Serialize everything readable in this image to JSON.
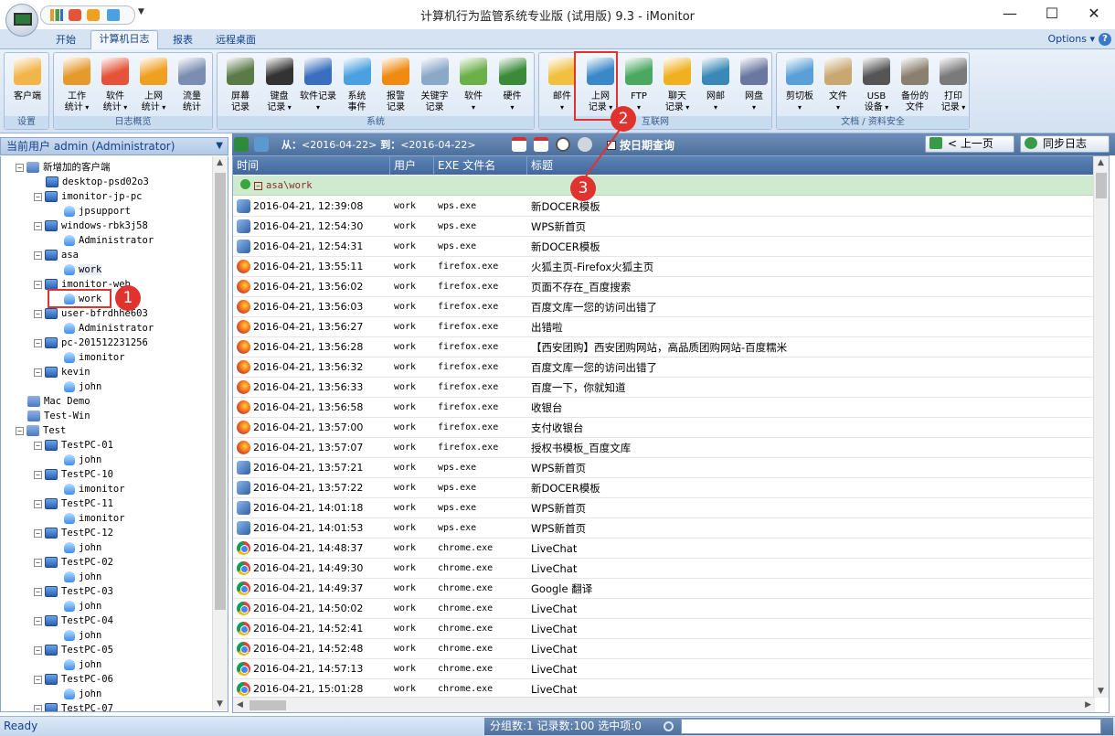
{
  "window": {
    "title": "计算机行为监管系统专业版 (试用版) 9.3 - iMonitor",
    "minimize": "—",
    "maximize": "☐",
    "close": "✕"
  },
  "ribbon_tabs": [
    {
      "label": "开始"
    },
    {
      "label": "计算机日志",
      "active": true
    },
    {
      "label": "报表"
    },
    {
      "label": "远程桌面"
    }
  ],
  "options_label": "Options",
  "ribbon_groups": [
    {
      "label": "设置",
      "buttons": [
        {
          "l1": "客户端",
          "l2": "",
          "icon": "client-icon",
          "color": "#f2b54a"
        }
      ]
    },
    {
      "label": "日志概览",
      "buttons": [
        {
          "l1": "工作",
          "l2": "统计",
          "icon": "work-stats-icon",
          "color": "#e59a2c",
          "dd": true
        },
        {
          "l1": "软件",
          "l2": "统计",
          "icon": "software-stats-icon",
          "color": "#e5533a",
          "dd": true
        },
        {
          "l1": "上网",
          "l2": "统计",
          "icon": "web-stats-icon",
          "color": "#f0a020",
          "dd": true
        },
        {
          "l1": "流量",
          "l2": "统计",
          "icon": "traffic-stats-icon",
          "color": "#7b8db0"
        }
      ]
    },
    {
      "label": "系统",
      "buttons": [
        {
          "l1": "屏幕",
          "l2": "记录",
          "icon": "screen-icon",
          "color": "#5a7a48"
        },
        {
          "l1": "键盘",
          "l2": "记录",
          "icon": "keyboard-icon",
          "color": "#333333",
          "dd": true
        },
        {
          "l1": "软件记录",
          "l2": "",
          "icon": "software-log-icon",
          "color": "#3a6fc0",
          "dd": true
        },
        {
          "l1": "系统",
          "l2": "事件",
          "icon": "system-event-icon",
          "color": "#4aa0e0"
        },
        {
          "l1": "报警",
          "l2": "记录",
          "icon": "alarm-icon",
          "color": "#f08a10"
        },
        {
          "l1": "关键字",
          "l2": "记录",
          "icon": "keyword-icon",
          "color": "#8aa8c8"
        },
        {
          "l1": "软件",
          "l2": "",
          "icon": "software-icon",
          "color": "#6cb04a",
          "dd": true
        },
        {
          "l1": "硬件",
          "l2": "",
          "icon": "hardware-icon",
          "color": "#3a8a3a",
          "dd": true
        }
      ]
    },
    {
      "label": "互联网",
      "buttons": [
        {
          "l1": "邮件",
          "l2": "",
          "icon": "mail-icon",
          "color": "#f2c040",
          "dd": true
        },
        {
          "l1": "上网",
          "l2": "记录",
          "icon": "web-log-icon",
          "color": "#3a88c8",
          "dd": true
        },
        {
          "l1": "FTP",
          "l2": "",
          "icon": "ftp-icon",
          "color": "#4aa860",
          "dd": true
        },
        {
          "l1": "聊天",
          "l2": "记录",
          "icon": "chat-icon",
          "color": "#f0b020",
          "dd": true
        },
        {
          "l1": "网邮",
          "l2": "",
          "icon": "webmail-icon",
          "color": "#3a88b8",
          "dd": true
        },
        {
          "l1": "网盘",
          "l2": "",
          "icon": "netdisk-icon",
          "color": "#6a78a0",
          "dd": true
        }
      ]
    },
    {
      "label": "文档 / 资料安全",
      "buttons": [
        {
          "l1": "剪切板",
          "l2": "",
          "icon": "clipboard-icon",
          "color": "#5aa0d8",
          "dd": true
        },
        {
          "l1": "文件",
          "l2": "",
          "icon": "file-icon",
          "color": "#c8a870",
          "dd": true
        },
        {
          "l1": "USB",
          "l2": "设备",
          "icon": "usb-icon",
          "color": "#555555",
          "dd": true
        },
        {
          "l1": "备份的",
          "l2": "文件",
          "icon": "backup-icon",
          "color": "#8a8070"
        },
        {
          "l1": "打印",
          "l2": "记录",
          "icon": "print-icon",
          "color": "#7a7a7a",
          "dd": true
        }
      ]
    }
  ],
  "current_user_label": "当前用户 admin (Administrator)",
  "tree": [
    {
      "label": "新增加的客户端",
      "lvl": 0,
      "type": "group",
      "exp": "-"
    },
    {
      "label": "desktop-psd02o3",
      "lvl": 1,
      "type": "pc"
    },
    {
      "label": "imonitor-jp-pc",
      "lvl": 1,
      "type": "pc",
      "exp": "-"
    },
    {
      "label": "jpsupport",
      "lvl": 2,
      "type": "user"
    },
    {
      "label": "windows-rbk3j58",
      "lvl": 1,
      "type": "pc",
      "exp": "-"
    },
    {
      "label": "Administrator",
      "lvl": 2,
      "type": "user"
    },
    {
      "label": "asa",
      "lvl": 1,
      "type": "pc",
      "exp": "-"
    },
    {
      "label": "work",
      "lvl": 2,
      "type": "user",
      "selected": true
    },
    {
      "label": "imonitor-web",
      "lvl": 1,
      "type": "pc",
      "exp": "-"
    },
    {
      "label": "work",
      "lvl": 2,
      "type": "user"
    },
    {
      "label": "user-bfrdhhe603",
      "lvl": 1,
      "type": "pc",
      "exp": "-"
    },
    {
      "label": "Administrator",
      "lvl": 2,
      "type": "user"
    },
    {
      "label": "pc-201512231256",
      "lvl": 1,
      "type": "pc",
      "exp": "-"
    },
    {
      "label": "imonitor",
      "lvl": 2,
      "type": "user"
    },
    {
      "label": "kevin",
      "lvl": 1,
      "type": "pc",
      "exp": "-"
    },
    {
      "label": "john",
      "lvl": 2,
      "type": "user"
    },
    {
      "label": "Mac Demo",
      "lvl": 0,
      "type": "group"
    },
    {
      "label": "Test-Win",
      "lvl": 0,
      "type": "group"
    },
    {
      "label": "Test",
      "lvl": 0,
      "type": "group",
      "exp": "-"
    },
    {
      "label": "TestPC-01",
      "lvl": 1,
      "type": "pc",
      "exp": "-"
    },
    {
      "label": "john",
      "lvl": 2,
      "type": "user"
    },
    {
      "label": "TestPC-10",
      "lvl": 1,
      "type": "pc",
      "exp": "-"
    },
    {
      "label": "imonitor",
      "lvl": 2,
      "type": "user"
    },
    {
      "label": "TestPC-11",
      "lvl": 1,
      "type": "pc",
      "exp": "-"
    },
    {
      "label": "imonitor",
      "lvl": 2,
      "type": "user"
    },
    {
      "label": "TestPC-12",
      "lvl": 1,
      "type": "pc",
      "exp": "-"
    },
    {
      "label": "john",
      "lvl": 2,
      "type": "user"
    },
    {
      "label": "TestPC-02",
      "lvl": 1,
      "type": "pc",
      "exp": "-"
    },
    {
      "label": "john",
      "lvl": 2,
      "type": "user"
    },
    {
      "label": "TestPC-03",
      "lvl": 1,
      "type": "pc",
      "exp": "-"
    },
    {
      "label": "john",
      "lvl": 2,
      "type": "user"
    },
    {
      "label": "TestPC-04",
      "lvl": 1,
      "type": "pc",
      "exp": "-"
    },
    {
      "label": "john",
      "lvl": 2,
      "type": "user"
    },
    {
      "label": "TestPC-05",
      "lvl": 1,
      "type": "pc",
      "exp": "-"
    },
    {
      "label": "john",
      "lvl": 2,
      "type": "user"
    },
    {
      "label": "TestPC-06",
      "lvl": 1,
      "type": "pc",
      "exp": "-"
    },
    {
      "label": "john",
      "lvl": 2,
      "type": "user"
    },
    {
      "label": "TestPC-07",
      "lvl": 1,
      "type": "pc",
      "exp": "-"
    }
  ],
  "toolbar": {
    "from_label": "从：",
    "from_date": "<2016-04-22>",
    "to_label": " 到：",
    "to_date": "<2016-04-22>",
    "by_date_query": "按日期查询",
    "prev_page": "< 上一页",
    "sync_log": "同步日志"
  },
  "columns": [
    "时间",
    "用户",
    "EXE 文件名",
    "标题"
  ],
  "group_row": "asa\\work",
  "rows": [
    {
      "icon": "wps",
      "time": "2016-04-21, 12:39:08",
      "user": "work",
      "exe": "wps.exe",
      "title": "新DOCER模板"
    },
    {
      "icon": "wps",
      "time": "2016-04-21, 12:54:30",
      "user": "work",
      "exe": "wps.exe",
      "title": "WPS新首页"
    },
    {
      "icon": "wps",
      "time": "2016-04-21, 12:54:31",
      "user": "work",
      "exe": "wps.exe",
      "title": "新DOCER模板"
    },
    {
      "icon": "firefox",
      "time": "2016-04-21, 13:55:11",
      "user": "work",
      "exe": "firefox.exe",
      "title": "火狐主页-Firefox火狐主页"
    },
    {
      "icon": "firefox",
      "time": "2016-04-21, 13:56:02",
      "user": "work",
      "exe": "firefox.exe",
      "title": "页面不存在_百度搜索"
    },
    {
      "icon": "firefox",
      "time": "2016-04-21, 13:56:03",
      "user": "work",
      "exe": "firefox.exe",
      "title": "百度文库一您的访问出错了"
    },
    {
      "icon": "firefox",
      "time": "2016-04-21, 13:56:27",
      "user": "work",
      "exe": "firefox.exe",
      "title": "出错啦"
    },
    {
      "icon": "firefox",
      "time": "2016-04-21, 13:56:28",
      "user": "work",
      "exe": "firefox.exe",
      "title": "【西安团购】西安团购网站，高品质团购网站-百度糯米"
    },
    {
      "icon": "firefox",
      "time": "2016-04-21, 13:56:32",
      "user": "work",
      "exe": "firefox.exe",
      "title": "百度文库一您的访问出错了"
    },
    {
      "icon": "firefox",
      "time": "2016-04-21, 13:56:33",
      "user": "work",
      "exe": "firefox.exe",
      "title": "百度一下，你就知道"
    },
    {
      "icon": "firefox",
      "time": "2016-04-21, 13:56:58",
      "user": "work",
      "exe": "firefox.exe",
      "title": "收银台"
    },
    {
      "icon": "firefox",
      "time": "2016-04-21, 13:57:00",
      "user": "work",
      "exe": "firefox.exe",
      "title": "支付收银台"
    },
    {
      "icon": "firefox",
      "time": "2016-04-21, 13:57:07",
      "user": "work",
      "exe": "firefox.exe",
      "title": "授权书模板_百度文库"
    },
    {
      "icon": "wps",
      "time": "2016-04-21, 13:57:21",
      "user": "work",
      "exe": "wps.exe",
      "title": "WPS新首页"
    },
    {
      "icon": "wps",
      "time": "2016-04-21, 13:57:22",
      "user": "work",
      "exe": "wps.exe",
      "title": "新DOCER模板"
    },
    {
      "icon": "wps",
      "time": "2016-04-21, 14:01:18",
      "user": "work",
      "exe": "wps.exe",
      "title": "WPS新首页"
    },
    {
      "icon": "wps",
      "time": "2016-04-21, 14:01:53",
      "user": "work",
      "exe": "wps.exe",
      "title": "WPS新首页"
    },
    {
      "icon": "chrome",
      "time": "2016-04-21, 14:48:37",
      "user": "work",
      "exe": "chrome.exe",
      "title": "LiveChat"
    },
    {
      "icon": "chrome",
      "time": "2016-04-21, 14:49:30",
      "user": "work",
      "exe": "chrome.exe",
      "title": "LiveChat"
    },
    {
      "icon": "chrome",
      "time": "2016-04-21, 14:49:37",
      "user": "work",
      "exe": "chrome.exe",
      "title": "Google 翻译"
    },
    {
      "icon": "chrome",
      "time": "2016-04-21, 14:50:02",
      "user": "work",
      "exe": "chrome.exe",
      "title": "LiveChat"
    },
    {
      "icon": "chrome",
      "time": "2016-04-21, 14:52:41",
      "user": "work",
      "exe": "chrome.exe",
      "title": "LiveChat"
    },
    {
      "icon": "chrome",
      "time": "2016-04-21, 14:52:48",
      "user": "work",
      "exe": "chrome.exe",
      "title": "LiveChat"
    },
    {
      "icon": "chrome",
      "time": "2016-04-21, 14:57:13",
      "user": "work",
      "exe": "chrome.exe",
      "title": "LiveChat"
    },
    {
      "icon": "chrome",
      "time": "2016-04-21, 15:01:28",
      "user": "work",
      "exe": "chrome.exe",
      "title": "LiveChat"
    }
  ],
  "status": {
    "ready": "Ready",
    "summary": "分组数:1  记录数:100  选中项:0"
  },
  "annotations": [
    "1",
    "2",
    "3"
  ],
  "colors": {
    "accent": "#15428b",
    "annotation": "#e0332f",
    "header": "#4d6f9d"
  }
}
